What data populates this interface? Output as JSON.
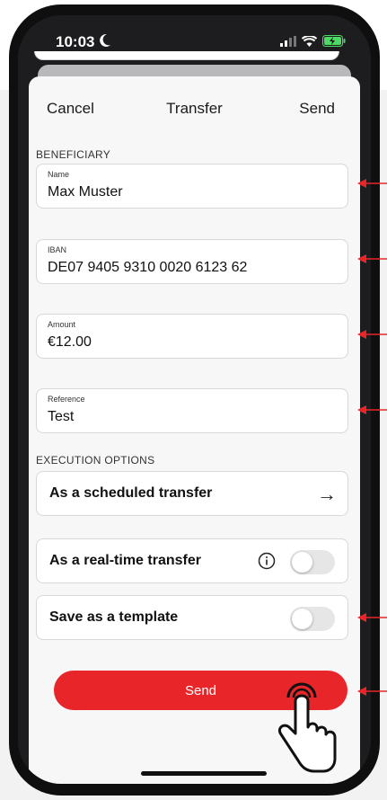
{
  "status_bar": {
    "time": "10:03"
  },
  "navbar": {
    "cancel": "Cancel",
    "title": "Transfer",
    "send": "Send"
  },
  "beneficiary": {
    "section_label": "BENEFICIARY",
    "name": {
      "label": "Name",
      "value": "Max Muster"
    },
    "iban": {
      "label": "IBAN",
      "value": "DE07 9405 9310 0020 6123 62"
    },
    "amount": {
      "label": "Amount",
      "value": "€12.00"
    },
    "reference": {
      "label": "Reference",
      "value": "Test"
    }
  },
  "execution": {
    "section_label": "EXECUTION OPTIONS",
    "scheduled": {
      "label": "As a scheduled transfer",
      "icon": "arrow-right-icon"
    },
    "realtime": {
      "label": "As a real-time transfer",
      "enabled": false,
      "icon": "info-icon"
    },
    "template": {
      "label": "Save as a template",
      "enabled": false
    }
  },
  "send_button": {
    "label": "Send",
    "color": "#e8262a"
  },
  "annotation_color": "#e8262a"
}
